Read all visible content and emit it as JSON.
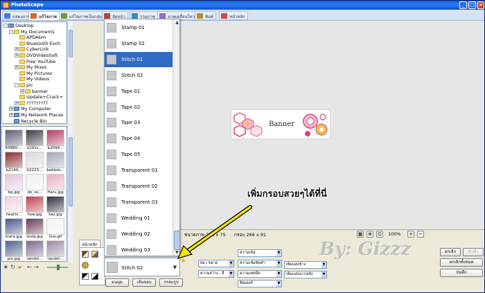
{
  "window": {
    "title": "PhotoScape"
  },
  "tabs": [
    {
      "label": "แสดงภาพ",
      "color": "#4a7bd0"
    },
    {
      "label": "แก้ไขภาพ",
      "color": "#d06a2a"
    },
    {
      "label": "แก้ไขภาพเป็นกลุ่ม",
      "color": "#6a9a3a"
    },
    {
      "label": "จัดหน้า",
      "color": "#c04040"
    },
    {
      "label": "รวมภาพ",
      "color": "#3a8ac0"
    },
    {
      "label": "ภาพเคลื่อนไหว",
      "color": "#9a6ac0"
    },
    {
      "label": "พิมพ์",
      "color": "#c08a2a"
    },
    {
      "label": "หน้าหลัก",
      "color": "#d04a4a"
    }
  ],
  "active_tab_index": 1,
  "folder_tree": [
    {
      "label": "Desktop",
      "level": 0,
      "exp": "-",
      "blue": true
    },
    {
      "label": "My Documents",
      "level": 1,
      "exp": "-"
    },
    {
      "label": "APDAbm",
      "level": 2,
      "exp": ""
    },
    {
      "label": "Bluetooth Exch",
      "level": 2,
      "exp": ""
    },
    {
      "label": "CyberLink",
      "level": 2,
      "exp": "+"
    },
    {
      "label": "DVDVideoSoft",
      "level": 2,
      "exp": "+"
    },
    {
      "label": "Free YouTube",
      "level": 2,
      "exp": ""
    },
    {
      "label": "My Music",
      "level": 2,
      "exp": "+"
    },
    {
      "label": "My Pictures",
      "level": 2,
      "exp": ""
    },
    {
      "label": "My Videos",
      "level": 2,
      "exp": ""
    },
    {
      "label": "pic",
      "level": 2,
      "exp": "-"
    },
    {
      "label": "banner",
      "level": 3,
      "exp": "+"
    },
    {
      "label": "Update+Crack+",
      "level": 2,
      "exp": ""
    },
    {
      "label": "?????????",
      "level": 2,
      "exp": "+"
    },
    {
      "label": "My Computer",
      "level": 1,
      "exp": "+",
      "blue": true
    },
    {
      "label": "My Network Places",
      "level": 1,
      "exp": "+",
      "blue": true
    },
    {
      "label": "Recycle Bin",
      "level": 1,
      "exp": "",
      "blue": true
    }
  ],
  "thumbnails": [
    {
      "caption": "65880-...",
      "color": "#5a6070"
    },
    {
      "caption": "a191c...",
      "color": "#3a3a45"
    },
    {
      "caption": "b2094...",
      "color": "#b04060"
    },
    {
      "caption": "b2144...",
      "color": "#8a2a2a"
    },
    {
      "caption": "b2223...",
      "color": "#d8d8e0"
    },
    {
      "caption": "beblelo...",
      "color": "#a0a8b8"
    },
    {
      "caption": "bg.jpg",
      "color": "#e0c8d8"
    },
    {
      "caption": "do_so...",
      "color": "#f0f0f0"
    },
    {
      "caption": "Haru.jpg",
      "color": "#e8b0c0"
    },
    {
      "caption": "hearts...",
      "color": "#f0d0e0"
    },
    {
      "caption": "how.jpg",
      "color": "#c04050"
    },
    {
      "caption": "kaz.jpg",
      "color": "#303040"
    },
    {
      "caption": "kiara.jpg",
      "color": "#4a5a8a"
    },
    {
      "caption": "leola.jpg",
      "color": "#6a3a5a"
    },
    {
      "caption": "line.gif",
      "color": "#f4f4f4"
    },
    {
      "caption": "pix.jpg",
      "color": "#506090"
    },
    {
      "caption": "randot...",
      "color": "#7a6a8a"
    },
    {
      "caption": "randot...",
      "color": "#9a8aa0"
    }
  ],
  "frame_list": [
    {
      "label": "Stamp 01"
    },
    {
      "label": "Stamp 02"
    },
    {
      "label": "Stitch 01",
      "selected": true
    },
    {
      "label": "Stitch 02"
    },
    {
      "label": "Tape 01"
    },
    {
      "label": "Tape 02"
    },
    {
      "label": "Tape 03"
    },
    {
      "label": "Tape 04"
    },
    {
      "label": "Tape 05"
    },
    {
      "label": "Transparent 01"
    },
    {
      "label": "Transparent 02"
    },
    {
      "label": "Transparent 03"
    },
    {
      "label": "Wedding 01"
    },
    {
      "label": "Wedding 02"
    },
    {
      "label": "Wedding 03"
    }
  ],
  "frame_combo": {
    "value": "Stitch 02"
  },
  "canvas": {
    "banner_text": "Banner"
  },
  "status": {
    "image_size": "ขนาดภาพ 259 x 75",
    "frame_size": "กรอบ 266 x 91",
    "zoom": "100%"
  },
  "panel_tabs": {
    "home": "หน้าหลัก"
  },
  "edit_controls": {
    "brightness": "ความเข้ม",
    "resize": "ย่อ / ขยาย",
    "sharpen": "ความเข้มขัดคำ",
    "color_ops": "ความสว่าง , สี",
    "darkness": "ความเทคมืด",
    "filter": "ฟิลเตอร์",
    "add_text": "เพิ่มแสงข้าง",
    "add_frame": "เพิ่มแสงฉากหลัง"
  },
  "frame_buttons": {
    "round": "มนมุม",
    "margin": "เส้นขอบ",
    "frame": "กรอบรูป"
  },
  "right_buttons": {
    "undo": "ยกเลิก",
    "redo": "ทำซ้ำ",
    "undo_all": "ยกเลิกทั้งหมด",
    "save": "บันทึก"
  },
  "annotation": {
    "text": "เพิ่มกรอบสวยๆได้ที่นี่"
  },
  "watermark": {
    "text": "By: Gizzz"
  }
}
